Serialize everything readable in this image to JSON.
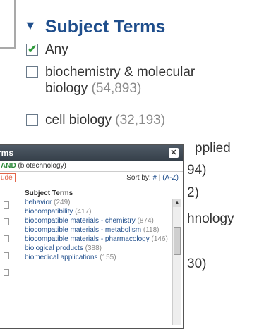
{
  "bg": {
    "title": "Subject Terms",
    "items": [
      {
        "label": "Any",
        "count": ""
      },
      {
        "label": "biochemistry & molecular",
        "count": ""
      },
      {
        "label": "biology",
        "count": "(54,893)"
      },
      {
        "label": "cell biology",
        "count": "(32,193)"
      }
    ],
    "partial": [
      "pplied",
      "94)",
      "2)",
      "hnology",
      "30)"
    ]
  },
  "popup": {
    "title": "rms",
    "query_and": "AND",
    "query_rest": "(biotechnology)",
    "exclude_label": "ude",
    "sort_label": "Sort by:",
    "sort_hash": "#",
    "sort_sep": "|",
    "sort_az": "(A-Z)",
    "column_header": "Subject Terms",
    "list": [
      {
        "name": "behavior",
        "count": "(249)"
      },
      {
        "name": "biocompatibility",
        "count": "(417)"
      },
      {
        "name": "biocompatible materials - chemistry",
        "count": "(874)"
      },
      {
        "name": "biocompatible materials - metabolism",
        "count": "(118)"
      },
      {
        "name": "biocompatible materials - pharmacology",
        "count": "(146)"
      },
      {
        "name": "biological products",
        "count": "(388)"
      },
      {
        "name": "biomedical applications",
        "count": "(155)"
      }
    ]
  }
}
